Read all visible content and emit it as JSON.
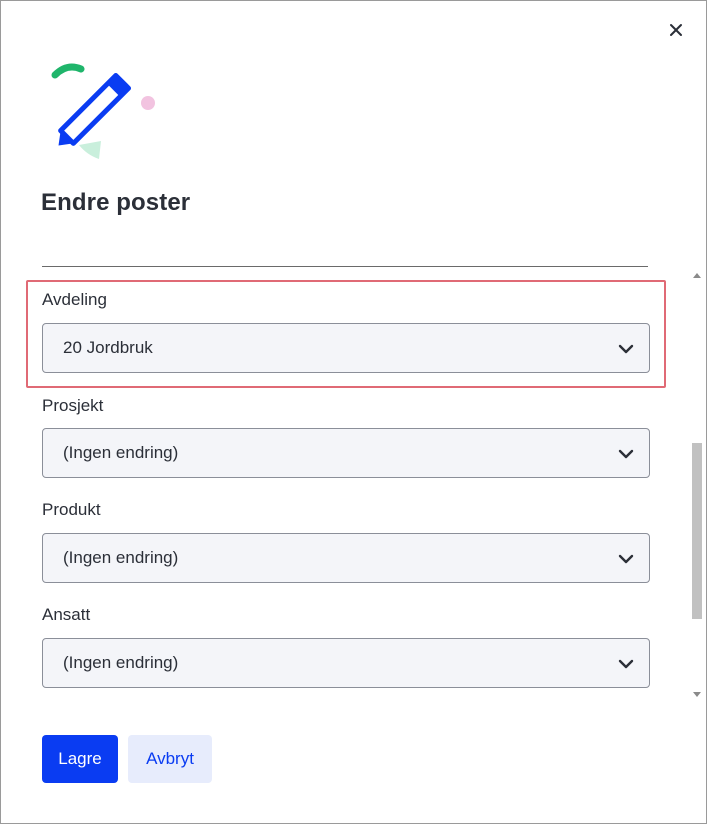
{
  "dialog": {
    "title": "Endre poster",
    "close_icon": "close-icon",
    "illustration_icon": "pencil-illustration"
  },
  "fields": [
    {
      "label": "Avdeling",
      "value": "20 Jordbruk",
      "highlighted": true
    },
    {
      "label": "Prosjekt",
      "value": "(Ingen endring)"
    },
    {
      "label": "Produkt",
      "value": "(Ingen endring)"
    },
    {
      "label": "Ansatt",
      "value": "(Ingen endring)"
    }
  ],
  "buttons": {
    "save": "Lagre",
    "cancel": "Avbryt"
  },
  "colors": {
    "primary": "#0a3cf2",
    "secondary_bg": "#e7ecfc",
    "highlight_border": "#e06a75",
    "select_bg": "#f4f5f9",
    "text": "#2b2f38"
  }
}
